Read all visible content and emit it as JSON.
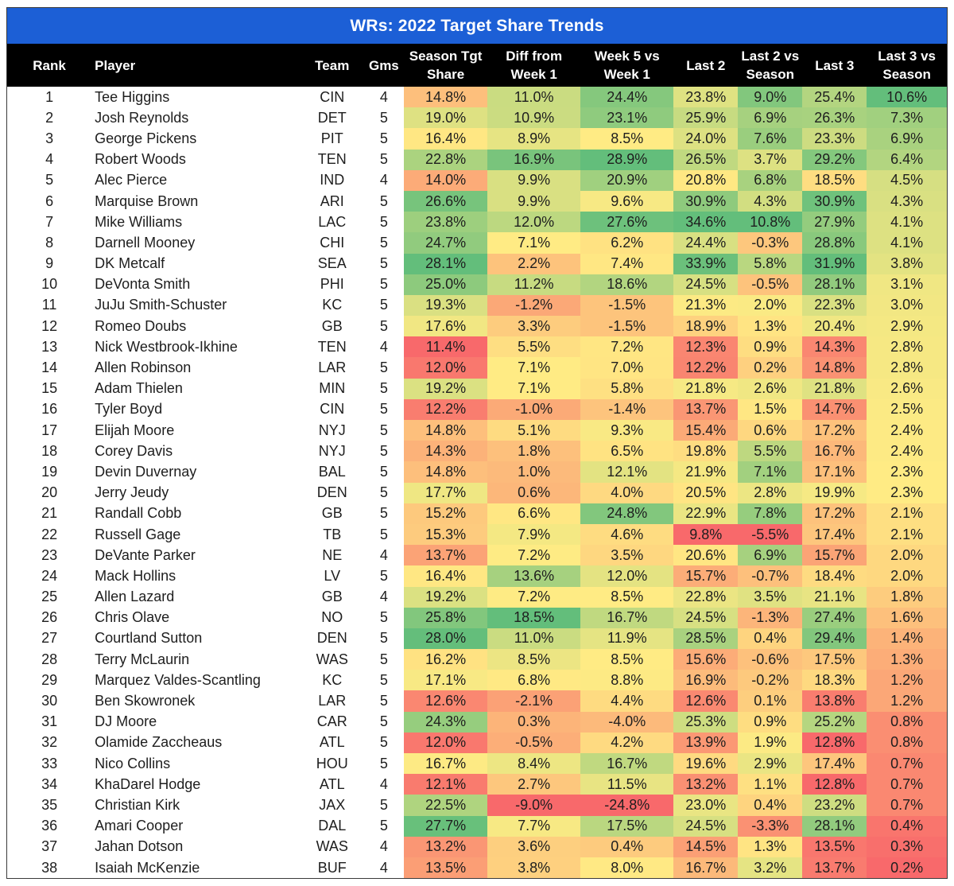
{
  "title": "WRs: 2022 Target Share Trends",
  "columns": [
    {
      "key": "rank",
      "label_1": "",
      "label_2": "Rank"
    },
    {
      "key": "player",
      "label_1": "",
      "label_2": "Player"
    },
    {
      "key": "team",
      "label_1": "",
      "label_2": "Team"
    },
    {
      "key": "gms",
      "label_1": "",
      "label_2": "Gms"
    },
    {
      "key": "season_tgt_share",
      "label_1": "Season Tgt",
      "label_2": "Share"
    },
    {
      "key": "diff_from_week1",
      "label_1": "Diff from",
      "label_2": "Week 1"
    },
    {
      "key": "week5_vs_week1",
      "label_1": "Week 5 vs",
      "label_2": "Week 1"
    },
    {
      "key": "last2",
      "label_1": "",
      "label_2": "Last 2"
    },
    {
      "key": "last2_vs_season",
      "label_1": "Last 2 vs",
      "label_2": "Season"
    },
    {
      "key": "last3",
      "label_1": "",
      "label_2": "Last 3"
    },
    {
      "key": "last3_vs_season",
      "label_1": "Last 3 vs",
      "label_2": "Season"
    }
  ],
  "color_scale": {
    "low": "#f8696b",
    "mid": "#ffeb84",
    "high": "#63be7b"
  },
  "rows": [
    {
      "rank": "1",
      "player": "Tee Higgins",
      "team": "CIN",
      "gms": "4",
      "season_tgt_share": "14.8%",
      "diff_from_week1": "11.0%",
      "week5_vs_week1": "24.4%",
      "last2": "23.8%",
      "last2_vs_season": "9.0%",
      "last3": "25.4%",
      "last3_vs_season": "10.6%"
    },
    {
      "rank": "2",
      "player": "Josh Reynolds",
      "team": "DET",
      "gms": "5",
      "season_tgt_share": "19.0%",
      "diff_from_week1": "10.9%",
      "week5_vs_week1": "23.1%",
      "last2": "25.9%",
      "last2_vs_season": "6.9%",
      "last3": "26.3%",
      "last3_vs_season": "7.3%"
    },
    {
      "rank": "3",
      "player": "George Pickens",
      "team": "PIT",
      "gms": "5",
      "season_tgt_share": "16.4%",
      "diff_from_week1": "8.9%",
      "week5_vs_week1": "8.5%",
      "last2": "24.0%",
      "last2_vs_season": "7.6%",
      "last3": "23.3%",
      "last3_vs_season": "6.9%"
    },
    {
      "rank": "4",
      "player": "Robert Woods",
      "team": "TEN",
      "gms": "5",
      "season_tgt_share": "22.8%",
      "diff_from_week1": "16.9%",
      "week5_vs_week1": "28.9%",
      "last2": "26.5%",
      "last2_vs_season": "3.7%",
      "last3": "29.2%",
      "last3_vs_season": "6.4%"
    },
    {
      "rank": "5",
      "player": "Alec Pierce",
      "team": "IND",
      "gms": "4",
      "season_tgt_share": "14.0%",
      "diff_from_week1": "9.9%",
      "week5_vs_week1": "20.9%",
      "last2": "20.8%",
      "last2_vs_season": "6.8%",
      "last3": "18.5%",
      "last3_vs_season": "4.5%"
    },
    {
      "rank": "6",
      "player": "Marquise Brown",
      "team": "ARI",
      "gms": "5",
      "season_tgt_share": "26.6%",
      "diff_from_week1": "9.9%",
      "week5_vs_week1": "9.6%",
      "last2": "30.9%",
      "last2_vs_season": "4.3%",
      "last3": "30.9%",
      "last3_vs_season": "4.3%"
    },
    {
      "rank": "7",
      "player": "Mike Williams",
      "team": "LAC",
      "gms": "5",
      "season_tgt_share": "23.8%",
      "diff_from_week1": "12.0%",
      "week5_vs_week1": "27.6%",
      "last2": "34.6%",
      "last2_vs_season": "10.8%",
      "last3": "27.9%",
      "last3_vs_season": "4.1%"
    },
    {
      "rank": "8",
      "player": "Darnell Mooney",
      "team": "CHI",
      "gms": "5",
      "season_tgt_share": "24.7%",
      "diff_from_week1": "7.1%",
      "week5_vs_week1": "6.2%",
      "last2": "24.4%",
      "last2_vs_season": "-0.3%",
      "last3": "28.8%",
      "last3_vs_season": "4.1%"
    },
    {
      "rank": "9",
      "player": "DK Metcalf",
      "team": "SEA",
      "gms": "5",
      "season_tgt_share": "28.1%",
      "diff_from_week1": "2.2%",
      "week5_vs_week1": "7.4%",
      "last2": "33.9%",
      "last2_vs_season": "5.8%",
      "last3": "31.9%",
      "last3_vs_season": "3.8%"
    },
    {
      "rank": "10",
      "player": "DeVonta Smith",
      "team": "PHI",
      "gms": "5",
      "season_tgt_share": "25.0%",
      "diff_from_week1": "11.2%",
      "week5_vs_week1": "18.6%",
      "last2": "24.5%",
      "last2_vs_season": "-0.5%",
      "last3": "28.1%",
      "last3_vs_season": "3.1%"
    },
    {
      "rank": "11",
      "player": "JuJu Smith-Schuster",
      "team": "KC",
      "gms": "5",
      "season_tgt_share": "19.3%",
      "diff_from_week1": "-1.2%",
      "week5_vs_week1": "-1.5%",
      "last2": "21.3%",
      "last2_vs_season": "2.0%",
      "last3": "22.3%",
      "last3_vs_season": "3.0%"
    },
    {
      "rank": "12",
      "player": "Romeo Doubs",
      "team": "GB",
      "gms": "5",
      "season_tgt_share": "17.6%",
      "diff_from_week1": "3.3%",
      "week5_vs_week1": "-1.5%",
      "last2": "18.9%",
      "last2_vs_season": "1.3%",
      "last3": "20.4%",
      "last3_vs_season": "2.9%"
    },
    {
      "rank": "13",
      "player": "Nick Westbrook-Ikhine",
      "team": "TEN",
      "gms": "4",
      "season_tgt_share": "11.4%",
      "diff_from_week1": "5.5%",
      "week5_vs_week1": "7.2%",
      "last2": "12.3%",
      "last2_vs_season": "0.9%",
      "last3": "14.3%",
      "last3_vs_season": "2.8%"
    },
    {
      "rank": "14",
      "player": "Allen Robinson",
      "team": "LAR",
      "gms": "5",
      "season_tgt_share": "12.0%",
      "diff_from_week1": "7.1%",
      "week5_vs_week1": "7.0%",
      "last2": "12.2%",
      "last2_vs_season": "0.2%",
      "last3": "14.8%",
      "last3_vs_season": "2.8%"
    },
    {
      "rank": "15",
      "player": "Adam Thielen",
      "team": "MIN",
      "gms": "5",
      "season_tgt_share": "19.2%",
      "diff_from_week1": "7.1%",
      "week5_vs_week1": "5.8%",
      "last2": "21.8%",
      "last2_vs_season": "2.6%",
      "last3": "21.8%",
      "last3_vs_season": "2.6%"
    },
    {
      "rank": "16",
      "player": "Tyler Boyd",
      "team": "CIN",
      "gms": "5",
      "season_tgt_share": "12.2%",
      "diff_from_week1": "-1.0%",
      "week5_vs_week1": "-1.4%",
      "last2": "13.7%",
      "last2_vs_season": "1.5%",
      "last3": "14.7%",
      "last3_vs_season": "2.5%"
    },
    {
      "rank": "17",
      "player": "Elijah Moore",
      "team": "NYJ",
      "gms": "5",
      "season_tgt_share": "14.8%",
      "diff_from_week1": "5.1%",
      "week5_vs_week1": "9.3%",
      "last2": "15.4%",
      "last2_vs_season": "0.6%",
      "last3": "17.2%",
      "last3_vs_season": "2.4%"
    },
    {
      "rank": "18",
      "player": "Corey Davis",
      "team": "NYJ",
      "gms": "5",
      "season_tgt_share": "14.3%",
      "diff_from_week1": "1.8%",
      "week5_vs_week1": "6.5%",
      "last2": "19.8%",
      "last2_vs_season": "5.5%",
      "last3": "16.7%",
      "last3_vs_season": "2.4%"
    },
    {
      "rank": "19",
      "player": "Devin Duvernay",
      "team": "BAL",
      "gms": "5",
      "season_tgt_share": "14.8%",
      "diff_from_week1": "1.0%",
      "week5_vs_week1": "12.1%",
      "last2": "21.9%",
      "last2_vs_season": "7.1%",
      "last3": "17.1%",
      "last3_vs_season": "2.3%"
    },
    {
      "rank": "20",
      "player": "Jerry Jeudy",
      "team": "DEN",
      "gms": "5",
      "season_tgt_share": "17.7%",
      "diff_from_week1": "0.6%",
      "week5_vs_week1": "4.0%",
      "last2": "20.5%",
      "last2_vs_season": "2.8%",
      "last3": "19.9%",
      "last3_vs_season": "2.3%"
    },
    {
      "rank": "21",
      "player": "Randall Cobb",
      "team": "GB",
      "gms": "5",
      "season_tgt_share": "15.2%",
      "diff_from_week1": "6.6%",
      "week5_vs_week1": "24.8%",
      "last2": "22.9%",
      "last2_vs_season": "7.8%",
      "last3": "17.2%",
      "last3_vs_season": "2.1%"
    },
    {
      "rank": "22",
      "player": "Russell Gage",
      "team": "TB",
      "gms": "5",
      "season_tgt_share": "15.3%",
      "diff_from_week1": "7.9%",
      "week5_vs_week1": "4.6%",
      "last2": "9.8%",
      "last2_vs_season": "-5.5%",
      "last3": "17.4%",
      "last3_vs_season": "2.1%"
    },
    {
      "rank": "23",
      "player": "DeVante Parker",
      "team": "NE",
      "gms": "4",
      "season_tgt_share": "13.7%",
      "diff_from_week1": "7.2%",
      "week5_vs_week1": "3.5%",
      "last2": "20.6%",
      "last2_vs_season": "6.9%",
      "last3": "15.7%",
      "last3_vs_season": "2.0%"
    },
    {
      "rank": "24",
      "player": "Mack Hollins",
      "team": "LV",
      "gms": "5",
      "season_tgt_share": "16.4%",
      "diff_from_week1": "13.6%",
      "week5_vs_week1": "12.0%",
      "last2": "15.7%",
      "last2_vs_season": "-0.7%",
      "last3": "18.4%",
      "last3_vs_season": "2.0%"
    },
    {
      "rank": "25",
      "player": "Allen Lazard",
      "team": "GB",
      "gms": "4",
      "season_tgt_share": "19.2%",
      "diff_from_week1": "7.2%",
      "week5_vs_week1": "8.5%",
      "last2": "22.8%",
      "last2_vs_season": "3.5%",
      "last3": "21.1%",
      "last3_vs_season": "1.8%"
    },
    {
      "rank": "26",
      "player": "Chris Olave",
      "team": "NO",
      "gms": "5",
      "season_tgt_share": "25.8%",
      "diff_from_week1": "18.5%",
      "week5_vs_week1": "16.7%",
      "last2": "24.5%",
      "last2_vs_season": "-1.3%",
      "last3": "27.4%",
      "last3_vs_season": "1.6%"
    },
    {
      "rank": "27",
      "player": "Courtland Sutton",
      "team": "DEN",
      "gms": "5",
      "season_tgt_share": "28.0%",
      "diff_from_week1": "11.0%",
      "week5_vs_week1": "11.9%",
      "last2": "28.5%",
      "last2_vs_season": "0.4%",
      "last3": "29.4%",
      "last3_vs_season": "1.4%"
    },
    {
      "rank": "28",
      "player": "Terry McLaurin",
      "team": "WAS",
      "gms": "5",
      "season_tgt_share": "16.2%",
      "diff_from_week1": "8.5%",
      "week5_vs_week1": "8.5%",
      "last2": "15.6%",
      "last2_vs_season": "-0.6%",
      "last3": "17.5%",
      "last3_vs_season": "1.3%"
    },
    {
      "rank": "29",
      "player": "Marquez Valdes-Scantling",
      "team": "KC",
      "gms": "5",
      "season_tgt_share": "17.1%",
      "diff_from_week1": "6.8%",
      "week5_vs_week1": "8.8%",
      "last2": "16.9%",
      "last2_vs_season": "-0.2%",
      "last3": "18.3%",
      "last3_vs_season": "1.2%"
    },
    {
      "rank": "30",
      "player": "Ben Skowronek",
      "team": "LAR",
      "gms": "5",
      "season_tgt_share": "12.6%",
      "diff_from_week1": "-2.1%",
      "week5_vs_week1": "4.4%",
      "last2": "12.6%",
      "last2_vs_season": "0.1%",
      "last3": "13.8%",
      "last3_vs_season": "1.2%"
    },
    {
      "rank": "31",
      "player": "DJ Moore",
      "team": "CAR",
      "gms": "5",
      "season_tgt_share": "24.3%",
      "diff_from_week1": "0.3%",
      "week5_vs_week1": "-4.0%",
      "last2": "25.3%",
      "last2_vs_season": "0.9%",
      "last3": "25.2%",
      "last3_vs_season": "0.8%"
    },
    {
      "rank": "32",
      "player": "Olamide Zaccheaus",
      "team": "ATL",
      "gms": "5",
      "season_tgt_share": "12.0%",
      "diff_from_week1": "-0.5%",
      "week5_vs_week1": "4.2%",
      "last2": "13.9%",
      "last2_vs_season": "1.9%",
      "last3": "12.8%",
      "last3_vs_season": "0.8%"
    },
    {
      "rank": "33",
      "player": "Nico Collins",
      "team": "HOU",
      "gms": "5",
      "season_tgt_share": "16.7%",
      "diff_from_week1": "8.4%",
      "week5_vs_week1": "16.7%",
      "last2": "19.6%",
      "last2_vs_season": "2.9%",
      "last3": "17.4%",
      "last3_vs_season": "0.7%"
    },
    {
      "rank": "34",
      "player": "KhaDarel Hodge",
      "team": "ATL",
      "gms": "4",
      "season_tgt_share": "12.1%",
      "diff_from_week1": "2.7%",
      "week5_vs_week1": "11.5%",
      "last2": "13.2%",
      "last2_vs_season": "1.1%",
      "last3": "12.8%",
      "last3_vs_season": "0.7%"
    },
    {
      "rank": "35",
      "player": "Christian Kirk",
      "team": "JAX",
      "gms": "5",
      "season_tgt_share": "22.5%",
      "diff_from_week1": "-9.0%",
      "week5_vs_week1": "-24.8%",
      "last2": "23.0%",
      "last2_vs_season": "0.4%",
      "last3": "23.2%",
      "last3_vs_season": "0.7%"
    },
    {
      "rank": "36",
      "player": "Amari Cooper",
      "team": "DAL",
      "gms": "5",
      "season_tgt_share": "27.7%",
      "diff_from_week1": "7.7%",
      "week5_vs_week1": "17.5%",
      "last2": "24.5%",
      "last2_vs_season": "-3.3%",
      "last3": "28.1%",
      "last3_vs_season": "0.4%"
    },
    {
      "rank": "37",
      "player": "Jahan Dotson",
      "team": "WAS",
      "gms": "4",
      "season_tgt_share": "13.2%",
      "diff_from_week1": "3.6%",
      "week5_vs_week1": "0.4%",
      "last2": "14.5%",
      "last2_vs_season": "1.3%",
      "last3": "13.5%",
      "last3_vs_season": "0.3%"
    },
    {
      "rank": "38",
      "player": "Isaiah McKenzie",
      "team": "BUF",
      "gms": "4",
      "season_tgt_share": "13.5%",
      "diff_from_week1": "3.8%",
      "week5_vs_week1": "8.0%",
      "last2": "16.7%",
      "last2_vs_season": "3.2%",
      "last3": "13.7%",
      "last3_vs_season": "0.2%"
    }
  ]
}
